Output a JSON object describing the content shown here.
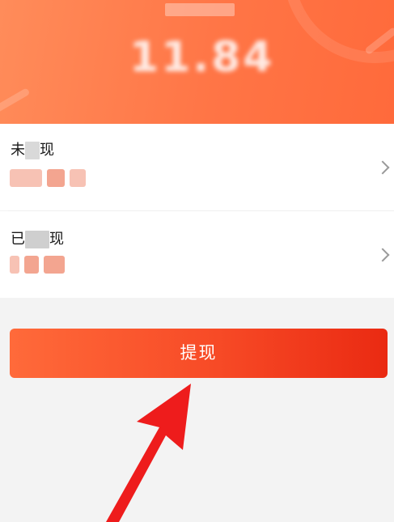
{
  "header": {
    "balance_amount": "11.84"
  },
  "rows": {
    "unwithdrawn": {
      "title_start": "未",
      "title_end": "现"
    },
    "withdrawn": {
      "title_start": "已",
      "title_end": "现"
    }
  },
  "withdraw_button": {
    "label": "提现"
  },
  "colors": {
    "header_gradient": [
      "#ff8c5a",
      "#ff6a3b"
    ],
    "button_gradient": [
      "#ff6a3a",
      "#ea2a12"
    ],
    "annotation_arrow": "#ee1c1c"
  },
  "icons": {
    "row_chevron": "chevron-right-icon",
    "annotation": "red-arrow-icon"
  }
}
